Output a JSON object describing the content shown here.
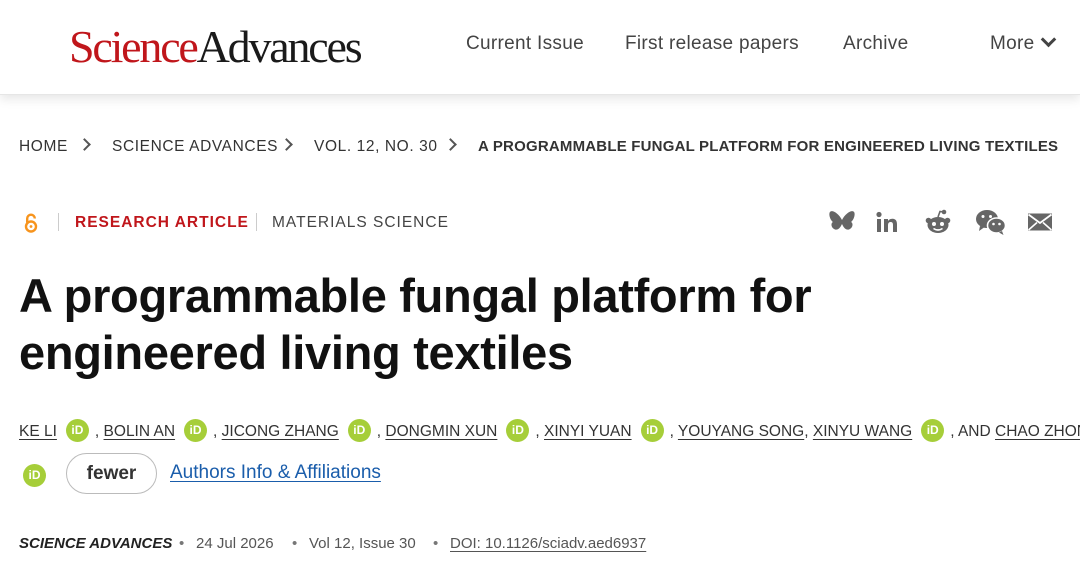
{
  "header": {
    "logo_part1": "Science",
    "logo_part2": "Advances",
    "nav": [
      "Current Issue",
      "First release papers",
      "Archive",
      "More"
    ]
  },
  "breadcrumb": [
    "HOME",
    "SCIENCE ADVANCES",
    "VOL. 12, NO. 30",
    "A PROGRAMMABLE FUNGAL PLATFORM FOR ENGINEERED LIVING TEXTILES"
  ],
  "article": {
    "type": "RESEARCH ARTICLE",
    "subject": "MATERIALS SCIENCE",
    "share_icons": [
      "bluesky-icon",
      "linkedin-icon",
      "reddit-icon",
      "wechat-icon",
      "email-icon"
    ],
    "title": "A programmable fungal platform for engineered living textiles",
    "authors": [
      "KE LI",
      "BOLIN AN",
      "JICONG ZHANG",
      "DONGMIN XUN",
      "XINYI YUAN",
      "YOUYANG SONG",
      "XINYU WANG",
      "CHAO ZHONG"
    ],
    "author_sep": ",",
    "author_and": ", AND",
    "orcid_label": "iD",
    "fewer_label": "fewer",
    "affiliations_label": "Authors Info & Affiliations"
  },
  "citation": {
    "journal": "SCIENCE ADVANCES",
    "bullet": "•",
    "date": "24 Jul 2026",
    "volume": "Vol 12, Issue 30",
    "doi": "DOI: 10.1126/sciadv.aed6937"
  },
  "colors": {
    "brand_red": "#c0161b",
    "orcid_green": "#a6ce39",
    "link_blue": "#1a5dab",
    "oa_orange": "#f7941d"
  }
}
